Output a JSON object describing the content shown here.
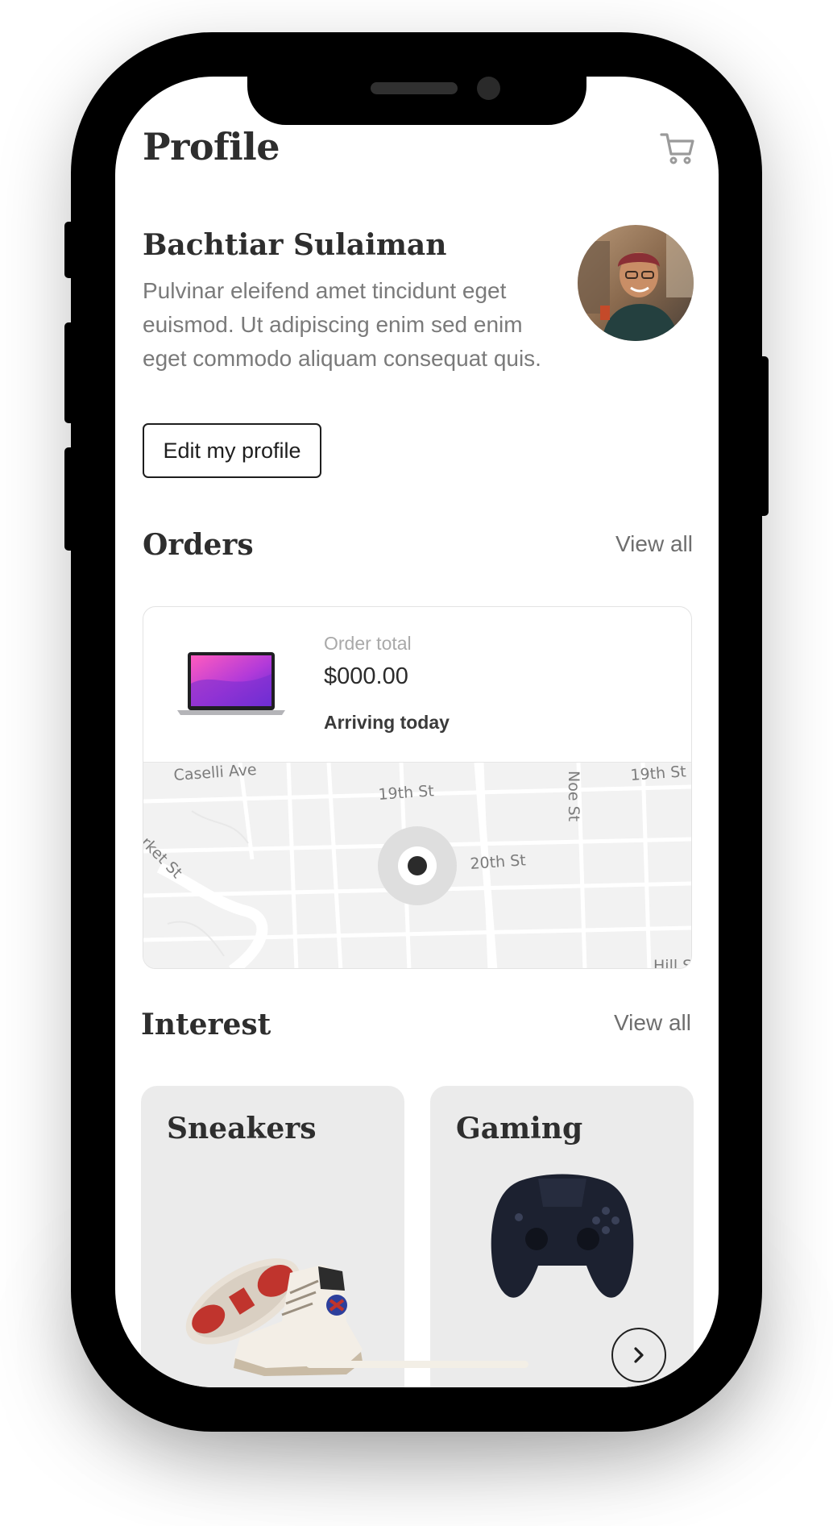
{
  "header": {
    "title": "Profile",
    "cart_icon": "cart-icon"
  },
  "profile": {
    "name": "Bachtiar Sulaiman",
    "bio": "Pulvinar eleifend amet tincidunt eget euismod. Ut adipiscing enim sed enim eget commodo aliquam consequat quis.",
    "edit_label": "Edit my profile"
  },
  "orders": {
    "title": "Orders",
    "view_all": "View all",
    "card": {
      "total_label": "Order total",
      "total_value": "$000.00",
      "status": "Arriving today",
      "map_streets": [
        "Caselli Ave",
        "19th St",
        "Noe St",
        "19th St",
        "20th St",
        "rket St",
        "Hill St"
      ]
    }
  },
  "interest": {
    "title": "Interest",
    "view_all": "View all",
    "cards": [
      {
        "label": "Sneakers"
      },
      {
        "label": "Gaming"
      }
    ]
  },
  "colors": {
    "text_dark": "#2e2e2e",
    "text_muted": "#7a7a7a",
    "card_bg": "#ebebeb",
    "laptop_screen_start": "#ff5bbf",
    "laptop_screen_end": "#5b2dd6"
  }
}
